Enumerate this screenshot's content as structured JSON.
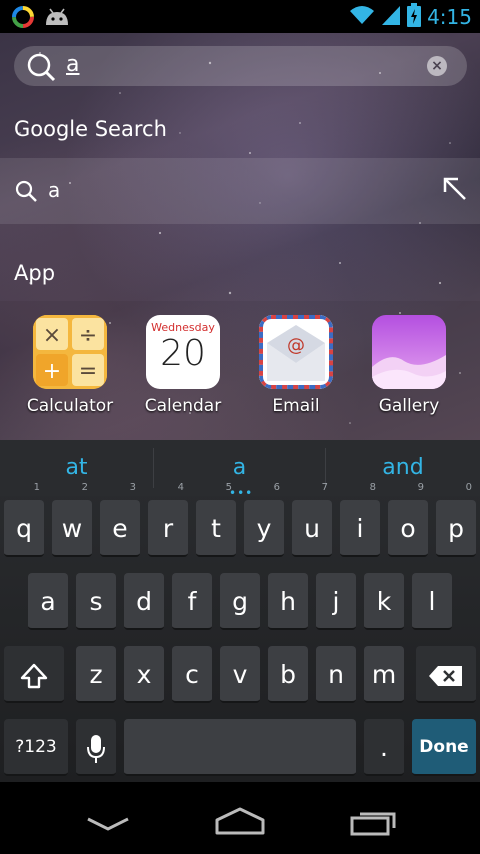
{
  "status_bar": {
    "time": "4:15",
    "icons": [
      "app-notification-icon",
      "android-icon",
      "wifi-icon",
      "signal-icon",
      "battery-charging-icon"
    ]
  },
  "search": {
    "query": "a",
    "clear_icon": "×"
  },
  "google_search": {
    "section_title": "Google Search",
    "suggestion": "a"
  },
  "apps": {
    "section_title": "App",
    "items": [
      {
        "label": "Calculator",
        "icon": "calculator-icon"
      },
      {
        "label": "Calendar",
        "icon": "calendar-icon",
        "weekday": "Wednesday",
        "day": "20"
      },
      {
        "label": "Email",
        "icon": "email-icon",
        "symbol": "@"
      },
      {
        "label": "Gallery",
        "icon": "gallery-icon"
      }
    ]
  },
  "calculator_glyphs": [
    "×",
    "÷",
    "+",
    "="
  ],
  "keyboard": {
    "suggestions": [
      "at",
      "a",
      "and"
    ],
    "suggestion_dots": "•••",
    "row1": [
      "q",
      "w",
      "e",
      "r",
      "t",
      "y",
      "u",
      "i",
      "o",
      "p"
    ],
    "row1_hints": [
      "1",
      "2",
      "3",
      "4",
      "5",
      "6",
      "7",
      "8",
      "9",
      "0"
    ],
    "row2": [
      "a",
      "s",
      "d",
      "f",
      "g",
      "h",
      "j",
      "k",
      "l"
    ],
    "row3": [
      "z",
      "x",
      "c",
      "v",
      "b",
      "n",
      "m"
    ],
    "symbols_label": "?123",
    "period_label": ".",
    "done_label": "Done",
    "accent_color": "#33b5e5"
  }
}
